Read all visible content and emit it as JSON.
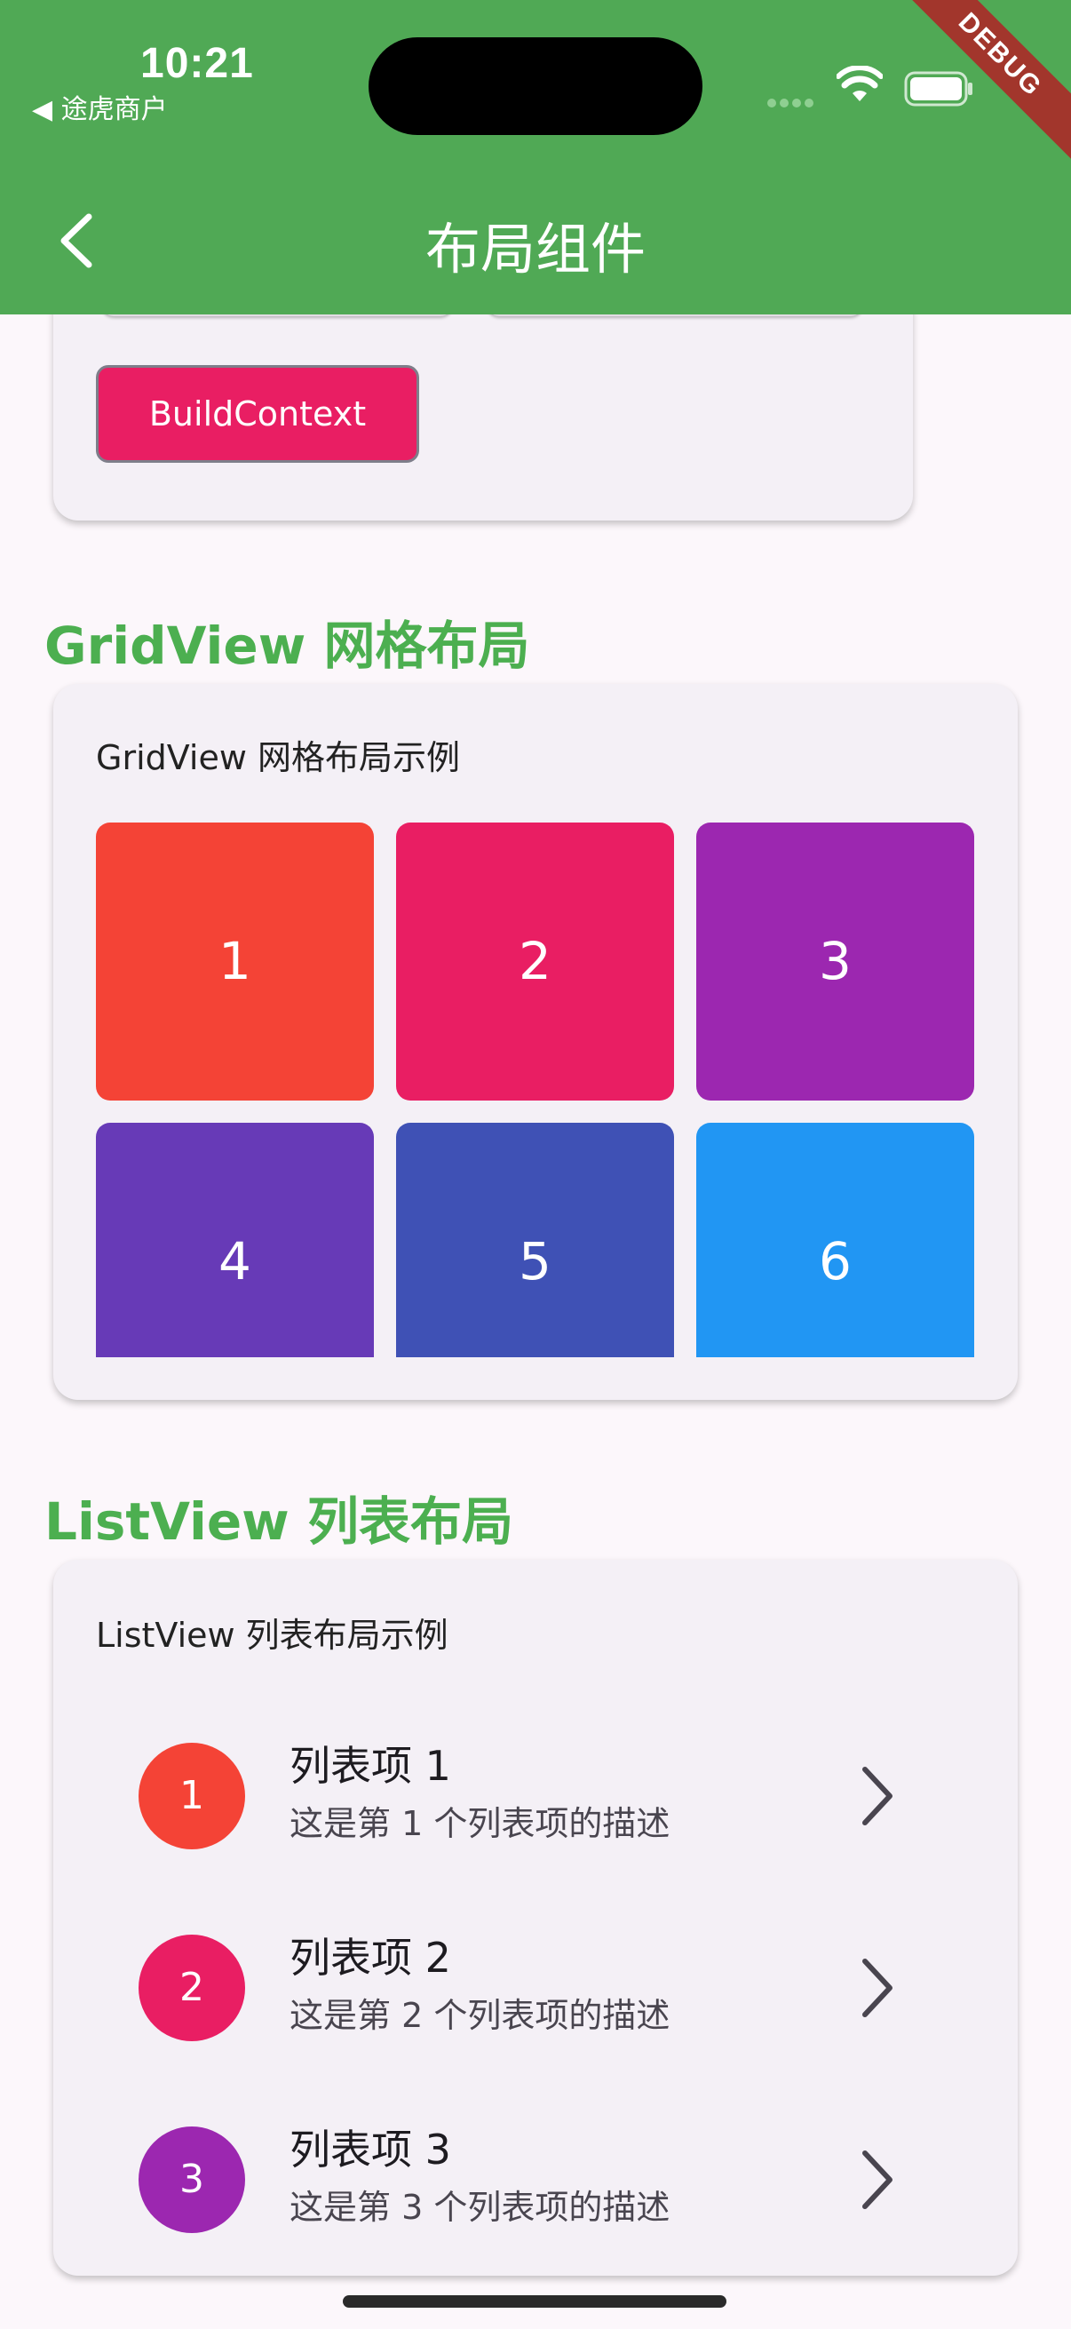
{
  "status_bar": {
    "time": "10:21",
    "back_app": "◀ 途虎商户"
  },
  "debug_banner": "DEBUG",
  "app_bar": {
    "title": "布局组件"
  },
  "prev_section": {
    "chip_label": "BuildContext"
  },
  "grid_section": {
    "title": "GridView 网格布局",
    "caption": "GridView 网格布局示例",
    "tiles": [
      {
        "label": "1",
        "color": "#f44336"
      },
      {
        "label": "2",
        "color": "#e91e63"
      },
      {
        "label": "3",
        "color": "#9c27b0"
      },
      {
        "label": "4",
        "color": "#673ab7"
      },
      {
        "label": "5",
        "color": "#3f51b5"
      },
      {
        "label": "6",
        "color": "#2196f3"
      }
    ]
  },
  "list_section": {
    "title": "ListView 列表布局",
    "caption": "ListView 列表布局示例",
    "items": [
      {
        "avatar": "1",
        "title": "列表项 1",
        "subtitle": "这是第 1 个列表项的描述",
        "color": "#f44336"
      },
      {
        "avatar": "2",
        "title": "列表项 2",
        "subtitle": "这是第 2 个列表项的描述",
        "color": "#e91e63"
      },
      {
        "avatar": "3",
        "title": "列表项 3",
        "subtitle": "这是第 3 个列表项的描述",
        "color": "#9c27b0"
      }
    ]
  },
  "colors": {
    "app_bar": "#50a955",
    "section_title": "#4caf50",
    "card": "#f4f0f6"
  },
  "icons": [
    "back-arrow-icon",
    "wifi-icon",
    "battery-icon",
    "chevron-right-icon"
  ]
}
